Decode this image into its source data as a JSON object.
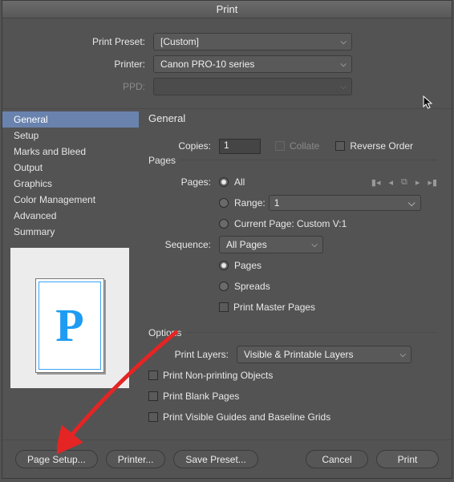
{
  "title": "Print",
  "top": {
    "preset_label": "Print Preset:",
    "preset_value": "[Custom]",
    "printer_label": "Printer:",
    "printer_value": "Canon PRO-10 series",
    "ppd_label": "PPD:",
    "ppd_value": ""
  },
  "sidebar": {
    "items": [
      "General",
      "Setup",
      "Marks and Bleed",
      "Output",
      "Graphics",
      "Color Management",
      "Advanced",
      "Summary"
    ]
  },
  "main": {
    "heading": "General",
    "copies_label": "Copies:",
    "copies_value": "1",
    "collate_label": "Collate",
    "reverse_label": "Reverse Order",
    "pages_group": "Pages",
    "pages_label": "Pages:",
    "all_label": "All",
    "range_label": "Range:",
    "range_value": "1",
    "current_label": "Current Page: Custom V:1",
    "sequence_label": "Sequence:",
    "sequence_value": "All Pages",
    "pages_radio": "Pages",
    "spreads_radio": "Spreads",
    "print_master": "Print Master Pages",
    "options_group": "Options",
    "layers_label": "Print Layers:",
    "layers_value": "Visible & Printable Layers",
    "nonprinting": "Print Non-printing Objects",
    "blank": "Print Blank Pages",
    "guides": "Print Visible Guides and Baseline Grids"
  },
  "preview_glyph": "P",
  "footer": {
    "page_setup": "Page Setup...",
    "printer": "Printer...",
    "save_preset": "Save Preset...",
    "cancel": "Cancel",
    "print": "Print"
  }
}
